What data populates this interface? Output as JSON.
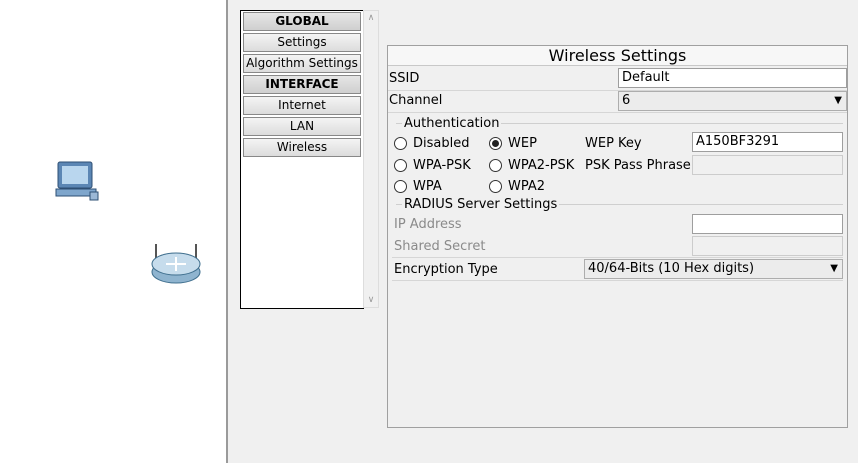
{
  "workspace": {
    "devices": [
      {
        "icon": "pc-icon"
      },
      {
        "icon": "wireless-router-icon"
      }
    ]
  },
  "nav": {
    "items": [
      {
        "label": "GLOBAL",
        "header": true
      },
      {
        "label": "Settings"
      },
      {
        "label": "Algorithm Settings"
      },
      {
        "label": "INTERFACE",
        "header": true
      },
      {
        "label": "Internet"
      },
      {
        "label": "LAN"
      },
      {
        "label": "Wireless"
      }
    ]
  },
  "wireless": {
    "title": "Wireless Settings",
    "ssid_label": "SSID",
    "ssid_value": "Default",
    "channel_label": "Channel",
    "channel_value": "6",
    "auth_title": "Authentication",
    "auth_options": {
      "disabled": "Disabled",
      "wep": "WEP",
      "wpa_psk": "WPA-PSK",
      "wpa2_psk": "WPA2-PSK",
      "wpa": "WPA",
      "wpa2": "WPA2"
    },
    "auth_selected": "WEP",
    "wep_key_label": "WEP Key",
    "wep_key_value": "A150BF3291",
    "psk_label": "PSK Pass Phrase",
    "psk_value": "",
    "radius_title": "RADIUS Server Settings",
    "ip_label": "IP Address",
    "ip_value": "",
    "secret_label": "Shared Secret",
    "secret_value": "",
    "encryption_label": "Encryption Type",
    "encryption_value": "40/64-Bits (10 Hex digits)"
  }
}
